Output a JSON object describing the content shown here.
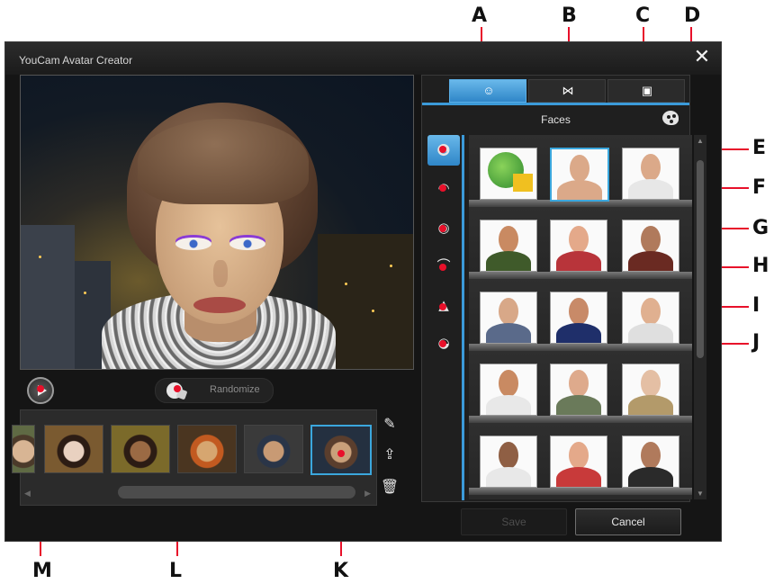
{
  "window": {
    "title": "YouCam Avatar Creator",
    "close_icon": "close-icon"
  },
  "panel": {
    "tabs": [
      {
        "id": "A",
        "icon": "avatar-face-icon",
        "active": true
      },
      {
        "id": "B",
        "icon": "bowtie-icon",
        "active": false
      },
      {
        "id": "C",
        "icon": "background-image-icon",
        "active": false
      }
    ],
    "title": "Faces",
    "palette_icon": "palette-icon",
    "categories": [
      {
        "id": "E",
        "icon": "face-icon",
        "active": true
      },
      {
        "id": "F",
        "icon": "hair-icon",
        "active": false
      },
      {
        "id": "G",
        "icon": "eye-icon",
        "active": false
      },
      {
        "id": "H",
        "icon": "eyebrow-icon",
        "active": false
      },
      {
        "id": "I",
        "icon": "nose-icon",
        "active": false
      },
      {
        "id": "J",
        "icon": "lips-icon",
        "active": false
      }
    ]
  },
  "controls": {
    "randomize_label": "Randomize",
    "play_icon": "play-icon"
  },
  "strip": {
    "thumbs": 5,
    "selected_index": 4,
    "tools": [
      "avatar-edit-icon",
      "share-icon",
      "trash-icon"
    ]
  },
  "footer": {
    "save_label": "Save",
    "cancel_label": "Cancel"
  },
  "callouts": [
    "A",
    "B",
    "C",
    "D",
    "E",
    "F",
    "G",
    "H",
    "I",
    "J",
    "K",
    "L",
    "M"
  ],
  "accent_color": "#3b9ad9",
  "callout_line_color": "#e8102a"
}
